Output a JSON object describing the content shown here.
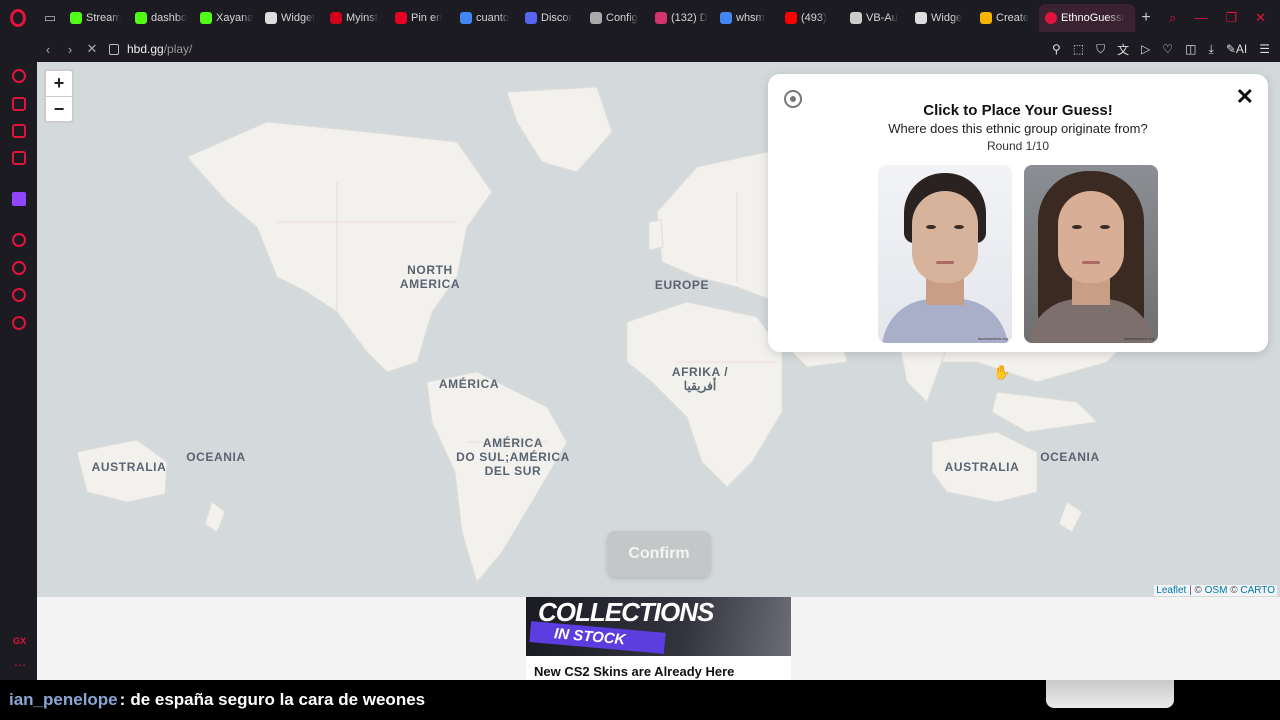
{
  "browser": {
    "tabs": [
      {
        "label": "Stream",
        "icon": "kick-icon",
        "color": "#53fc18"
      },
      {
        "label": "dashbo",
        "icon": "kick-icon",
        "color": "#53fc18"
      },
      {
        "label": "Xayana",
        "icon": "kick-icon",
        "color": "#53fc18"
      },
      {
        "label": "Widget",
        "icon": "widget-icon",
        "color": "#dddddd"
      },
      {
        "label": "Myinst",
        "icon": "myinstants-icon",
        "color": "#d0021b"
      },
      {
        "label": "Pin en",
        "icon": "pinterest-icon",
        "color": "#e60023"
      },
      {
        "label": "cuanto",
        "icon": "google-icon",
        "color": "#4285f4"
      },
      {
        "label": "Discor",
        "icon": "discord-icon",
        "color": "#5865f2"
      },
      {
        "label": "Config",
        "icon": "gear-icon",
        "color": "#aaaaaa"
      },
      {
        "label": "(132) D",
        "icon": "badge-icon",
        "color": "#d6336c"
      },
      {
        "label": "whsm",
        "icon": "google-icon",
        "color": "#4285f4"
      },
      {
        "label": "(493)",
        "icon": "youtube-icon",
        "color": "#ff0000"
      },
      {
        "label": "VB-Au",
        "icon": "vb-icon",
        "color": "#cccccc"
      },
      {
        "label": "Widge",
        "icon": "widget-icon",
        "color": "#dddddd"
      },
      {
        "label": "Create",
        "icon": "create-icon",
        "color": "#f4b400"
      }
    ],
    "active_tab": "EthnoGuessr",
    "url_host": "hbd.gg",
    "url_path": "/play/"
  },
  "map": {
    "labels": {
      "north_america": "NORTH\nAMERICA",
      "europe": "EUROPE",
      "america": "AMÉRICA",
      "afrika": "AFRIKA /\nأفريقيا",
      "south_america": "AMÉRICA\nDO SUL;AMÉRICA\nDEL SUR",
      "australia_left": "AUSTRALIA",
      "oceania_left": "OCEANIA",
      "australia_right": "AUSTRALIA",
      "oceania_right": "OCEANIA"
    },
    "zoom_in": "+",
    "zoom_out": "−",
    "attribution": {
      "leaflet": "Leaflet",
      "sep1": " | © ",
      "osm": "OSM",
      "sep2": " © ",
      "carto": "CARTO"
    },
    "confirm_label": "Confirm"
  },
  "panel": {
    "title": "Click to Place Your Guess!",
    "question": "Where does this ethnic group originate from?",
    "round": "Round 1/10",
    "close": "✕",
    "face_credit": "faceresearch.org"
  },
  "ad": {
    "headline": "COLLECTIONS",
    "tag": "IN STOCK",
    "title": "New CS2 Skins are Already Here"
  },
  "chat": {
    "user": "ian_penelope",
    "separator": ":",
    "message": "de españa seguro la cara de weones"
  }
}
